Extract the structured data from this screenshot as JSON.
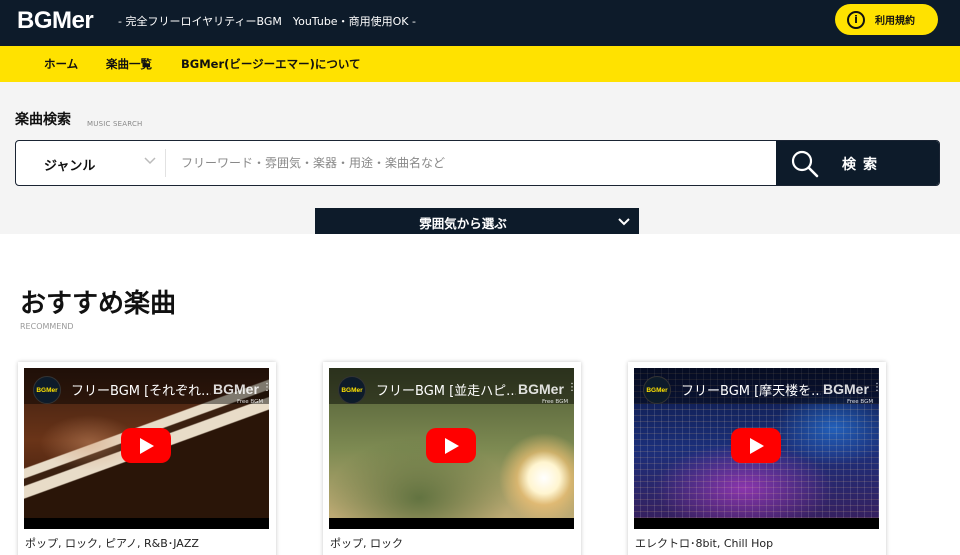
{
  "header": {
    "logo": "BGMer",
    "tagline": "- 完全フリーロイヤリティーBGM　YouTube・商用使用OK -",
    "terms_button": "利用規約",
    "terms_icon": "info-icon"
  },
  "nav": {
    "items": [
      {
        "label": "ホーム"
      },
      {
        "label": "楽曲一覧"
      },
      {
        "label": "BGMer(ビージーエマー)について"
      }
    ]
  },
  "search": {
    "title": "楽曲検索",
    "subtitle": "MUSIC SEARCH",
    "genre_label": "ジャンル",
    "placeholder": "フリーワード・雰囲気・楽器・用途・楽曲名など",
    "button_label": "検索",
    "mood_button": "雰囲気から選ぶ"
  },
  "recommend": {
    "title": "おすすめ楽曲",
    "subtitle": "RECOMMEND",
    "cards": [
      {
        "video_title": "フリーBGM [それぞれ...",
        "watermark": "BGMer",
        "watermark_sub": "Free BGM",
        "channel": "BGMer",
        "genres": "ポップ, ロック, ピアノ, R&B･JAZZ"
      },
      {
        "video_title": "フリーBGM [並走ハピ...",
        "watermark": "BGMer",
        "watermark_sub": "Free BGM",
        "channel": "BGMer",
        "genres": "ポップ, ロック"
      },
      {
        "video_title": "フリーBGM [摩天楼を...",
        "watermark": "BGMer",
        "watermark_sub": "Free BGM",
        "channel": "BGMer",
        "genres": "エレクトロ･8bit, Chill Hop"
      }
    ]
  },
  "colors": {
    "navy": "#0d1b2a",
    "yellow": "#ffe200",
    "search_bg": "#f4f4f4",
    "youtube_red": "#ff0000"
  }
}
